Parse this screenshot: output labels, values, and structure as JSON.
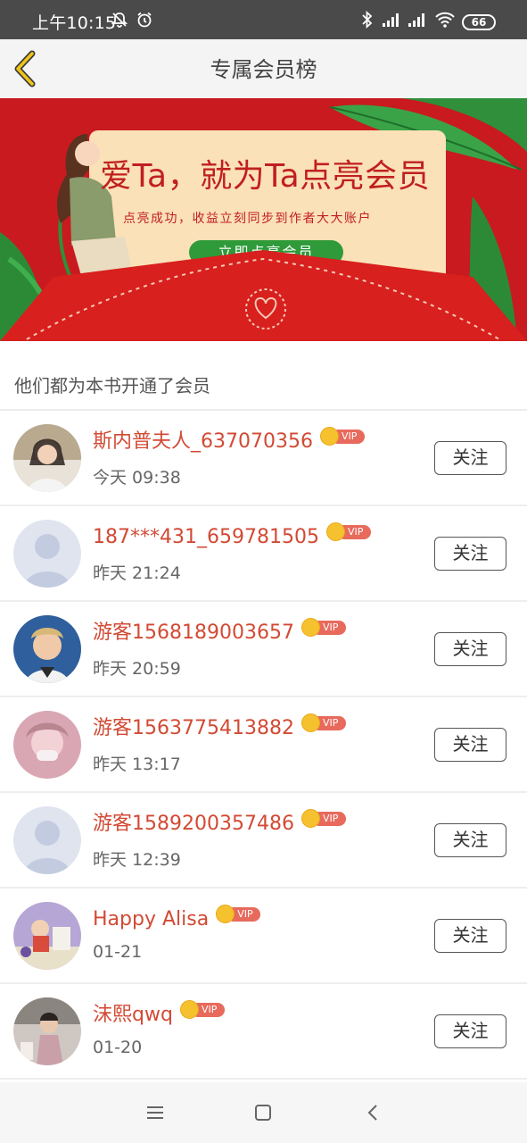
{
  "status_bar": {
    "time": "上午10:15",
    "battery": "66"
  },
  "header": {
    "title": "专属会员榜"
  },
  "banner": {
    "headline": "爱Ta，就为Ta点亮会员",
    "subtitle": "点亮成功，收益立刻同步到作者大大账户",
    "cta": "立即点亮会员"
  },
  "section": {
    "title": "他们都为本书开通了会员"
  },
  "members": [
    {
      "name": "斯内普夫人_637070356",
      "time": "今天 09:38",
      "badge": "VIP",
      "follow_label": "关注"
    },
    {
      "name": "187***431_659781505",
      "time": "昨天 21:24",
      "badge": "VIP",
      "follow_label": "关注"
    },
    {
      "name": "游客1568189003657",
      "time": "昨天 20:59",
      "badge": "VIP",
      "follow_label": "关注"
    },
    {
      "name": "游客1563775413882",
      "time": "昨天 13:17",
      "badge": "VIP",
      "follow_label": "关注"
    },
    {
      "name": "游客1589200357486",
      "time": "昨天 12:39",
      "badge": "VIP",
      "follow_label": "关注"
    },
    {
      "name": "Happy Alisa",
      "time": "01-21",
      "badge": "VIP",
      "follow_label": "关注"
    },
    {
      "name": "沫熙qwq",
      "time": "01-20",
      "badge": "VIP",
      "follow_label": "关注"
    }
  ],
  "colors": {
    "accent_name": "#d24a34",
    "vip_tag": "#e86a5c",
    "banner_red": "#c81a1f",
    "back_arrow": "#f0c419"
  }
}
